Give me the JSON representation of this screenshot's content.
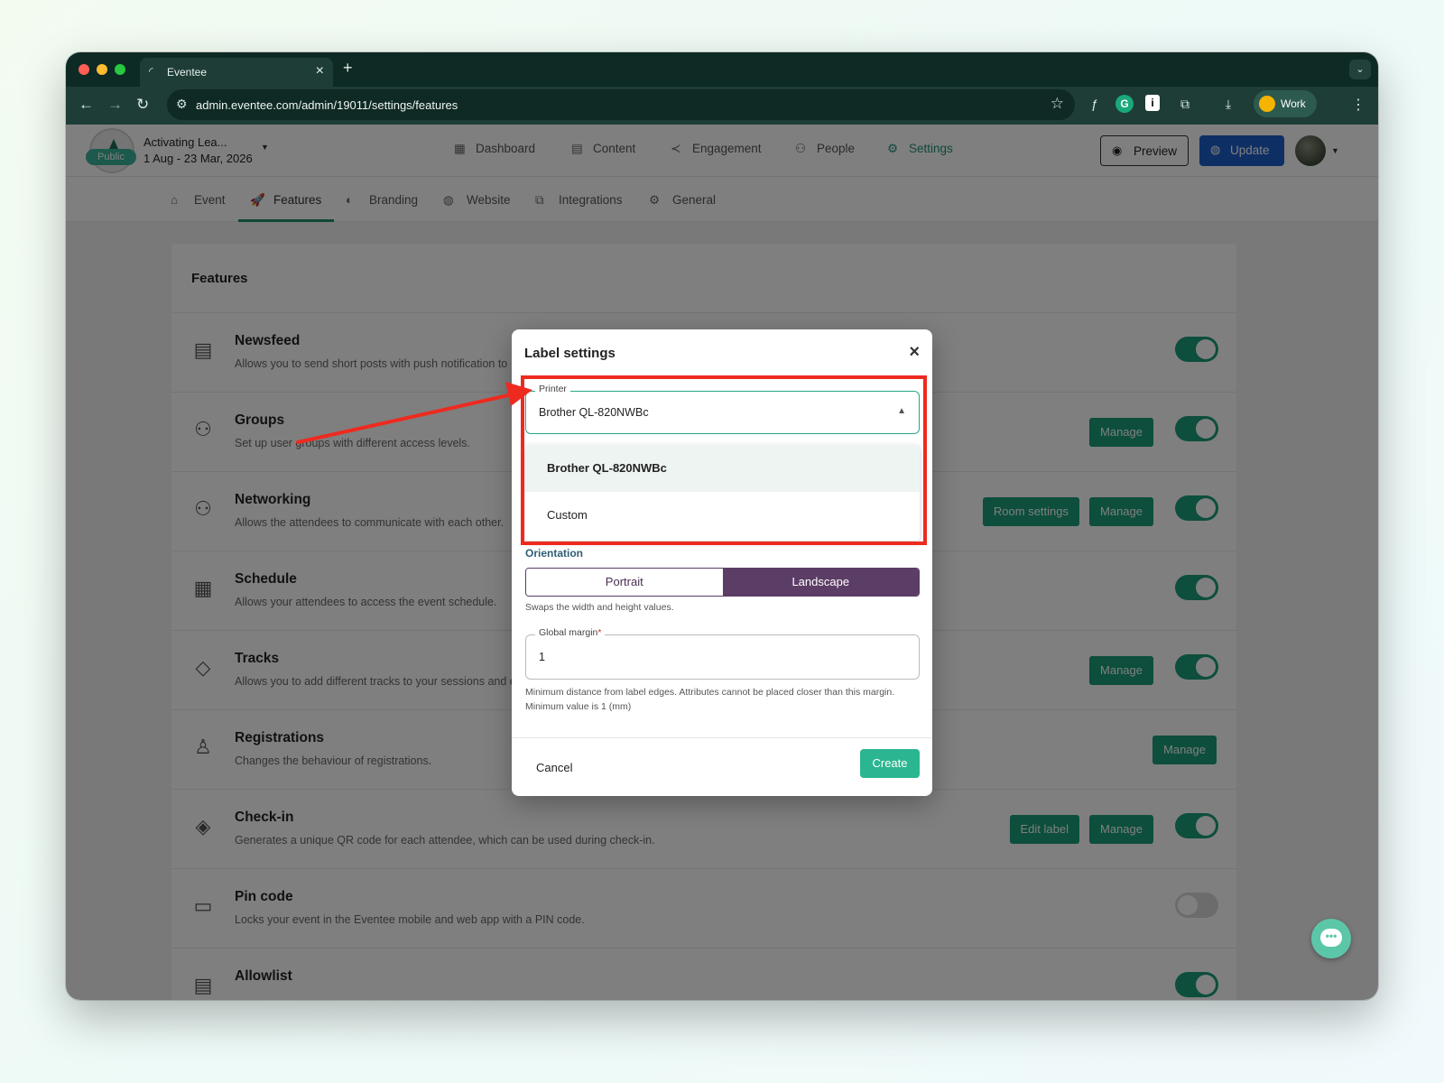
{
  "browser": {
    "tab_title": "Eventee",
    "url": "admin.eventee.com/admin/19011/settings/features",
    "profile_label": "Work",
    "colors": {
      "frame": "#0e2a24",
      "toolbar": "#1e3d36"
    }
  },
  "header": {
    "public_badge": "Public",
    "event_name": "Activating Lea...",
    "event_dates": "1 Aug - 23 Mar, 2026",
    "nav": [
      {
        "label": "Dashboard",
        "icon": "dashboard-icon"
      },
      {
        "label": "Content",
        "icon": "calendar-icon"
      },
      {
        "label": "Engagement",
        "icon": "share-icon"
      },
      {
        "label": "People",
        "icon": "people-icon"
      },
      {
        "label": "Settings",
        "icon": "gear-icon",
        "active": true
      }
    ],
    "preview_label": "Preview",
    "update_label": "Update"
  },
  "subnav": [
    {
      "label": "Event",
      "icon": "home-icon"
    },
    {
      "label": "Features",
      "icon": "rocket-icon",
      "active": true
    },
    {
      "label": "Branding",
      "icon": "palette-icon"
    },
    {
      "label": "Website",
      "icon": "globe-icon"
    },
    {
      "label": "Integrations",
      "icon": "puzzle-icon"
    },
    {
      "label": "General",
      "icon": "gears-icon"
    }
  ],
  "features": {
    "title": "Features",
    "rows": [
      {
        "name": "Newsfeed",
        "desc": "Allows you to send short posts with push notification to",
        "toggle": true
      },
      {
        "name": "Groups",
        "desc": "Set up user groups with different access levels.",
        "buttons": [
          "Manage"
        ],
        "toggle": true
      },
      {
        "name": "Networking",
        "desc": "Allows the attendees to communicate with each other.",
        "buttons": [
          "Room settings",
          "Manage"
        ],
        "toggle": true
      },
      {
        "name": "Schedule",
        "desc": "Allows your attendees to access the event schedule.",
        "toggle": true
      },
      {
        "name": "Tracks",
        "desc": "Allows you to add different tracks to your sessions and e",
        "buttons": [
          "Manage"
        ],
        "toggle": true
      },
      {
        "name": "Registrations",
        "desc": "Changes the behaviour of registrations.",
        "buttons": [
          "Manage"
        ]
      },
      {
        "name": "Check-in",
        "desc": "Generates a unique QR code for each attendee, which can be used during check-in.",
        "buttons": [
          "Edit label",
          "Manage"
        ],
        "toggle": true
      },
      {
        "name": "Pin code",
        "desc": "Locks your event in the Eventee mobile and web app with a PIN code.",
        "toggle": false
      },
      {
        "name": "Allowlist",
        "desc": "",
        "toggle": true
      }
    ]
  },
  "modal": {
    "title": "Label settings",
    "printer": {
      "label": "Printer",
      "value": "Brother QL-820NWBc",
      "options": [
        "Brother QL-820NWBc",
        "Custom"
      ]
    },
    "orientation": {
      "label": "Orientation",
      "options": [
        "Portrait",
        "Landscape"
      ],
      "selected": "Landscape",
      "hint": "Swaps the width and height values."
    },
    "margin": {
      "label": "Global margin",
      "required_mark": "*",
      "value": "1",
      "hint": "Minimum distance from label edges. Attributes cannot be placed closer than this margin. Minimum value is 1 (mm)"
    },
    "cancel_label": "Cancel",
    "create_label": "Create"
  }
}
